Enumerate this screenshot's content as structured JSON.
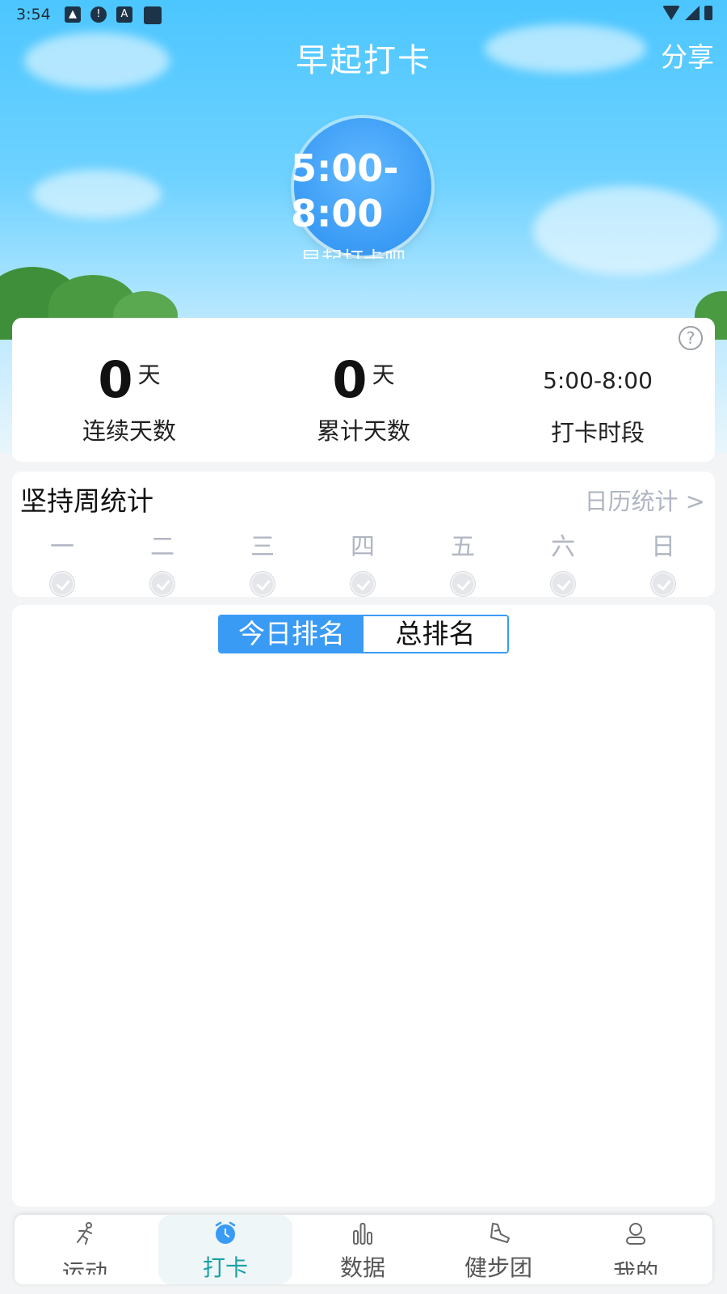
{
  "status_bar": {
    "time": "3:54"
  },
  "header": {
    "title": "早起打卡",
    "share_label": "分享"
  },
  "clock": {
    "time_range": "5:00-8:00",
    "subtitle": "早起打卡吧"
  },
  "stats": {
    "consecutive": {
      "value": "0",
      "unit": "天",
      "label": "连续天数"
    },
    "total": {
      "value": "0",
      "unit": "天",
      "label": "累计天数"
    },
    "period": {
      "value": "5:00-8:00",
      "label": "打卡时段"
    }
  },
  "week": {
    "title": "坚持周统计",
    "calendar_link": "日历统计 >",
    "days": [
      "一",
      "二",
      "三",
      "四",
      "五",
      "六",
      "日"
    ]
  },
  "ranking": {
    "tabs": [
      "今日排名",
      "总排名"
    ],
    "active_tab": 0
  },
  "nav": {
    "items": [
      {
        "label": "运动",
        "icon": "running-icon"
      },
      {
        "label": "打卡",
        "icon": "alarm-clock-icon"
      },
      {
        "label": "数据",
        "icon": "bar-chart-icon"
      },
      {
        "label": "健步团",
        "icon": "shoe-icon"
      },
      {
        "label": "我的",
        "icon": "user-icon"
      }
    ],
    "active_index": 1
  },
  "colors": {
    "accent": "#3a9bf5",
    "nav_active": "#1aa0a6"
  }
}
